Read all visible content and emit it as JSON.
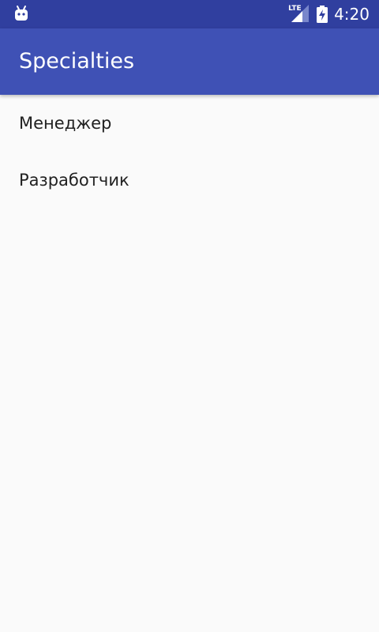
{
  "status_bar": {
    "network_label": "LTE",
    "time": "4:20",
    "bg_color": "#303F9F",
    "left_icon": "android-debug-icon",
    "signal_icon": "signal-icon",
    "battery_icon": "battery-charging-icon"
  },
  "app_bar": {
    "title": "Specialties",
    "bg_color": "#3F51B5"
  },
  "list": {
    "items": [
      {
        "label": "Менеджер"
      },
      {
        "label": "Разработчик"
      }
    ]
  }
}
